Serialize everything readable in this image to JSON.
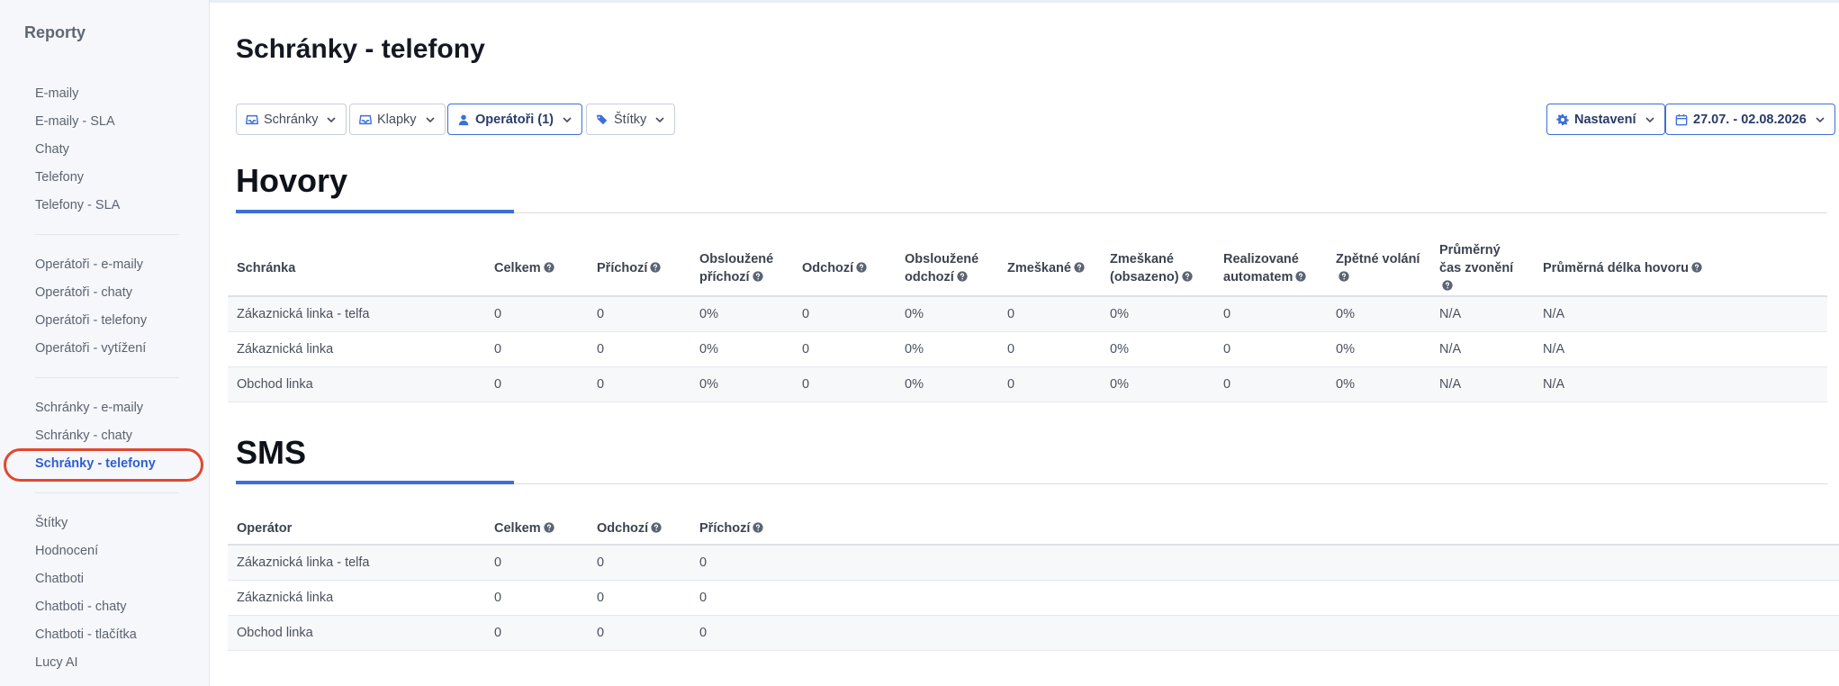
{
  "sidebar": {
    "title": "Reporty",
    "groups": [
      [
        "E-maily",
        "E-maily - SLA",
        "Chaty",
        "Telefony",
        "Telefony - SLA"
      ],
      [
        "Operátoři - e-maily",
        "Operátoři - chaty",
        "Operátoři - telefony",
        "Operátoři - vytížení"
      ],
      [
        "Schránky - e-maily",
        "Schránky - chaty",
        "Schránky - telefony"
      ],
      [
        "Štítky",
        "Hodnocení",
        "Chatboti",
        "Chatboti - chaty",
        "Chatboti - tlačítka",
        "Lucy AI"
      ]
    ],
    "active": "Schránky - telefony"
  },
  "page": {
    "title": "Schránky - telefony"
  },
  "filters": {
    "mailboxes": "Schránky",
    "extensions": "Klapky",
    "operators": "Operátoři (1)",
    "tags": "Štítky",
    "settings": "Nastavení",
    "date_range": "27.07. - 02.08.2026"
  },
  "icons": {
    "mailboxes": "inbox-icon",
    "extensions": "inbox-icon",
    "operators": "user-icon",
    "tags": "tags-icon",
    "settings": "gear-icon",
    "date_range": "calendar-icon",
    "help": "question-circle-icon",
    "dropdown": "chevron-down-icon"
  },
  "calls": {
    "title": "Hovory",
    "columns": [
      {
        "label": "Schránka",
        "help": false
      },
      {
        "label": "Celkem",
        "help": true
      },
      {
        "label": "Příchozí",
        "help": true
      },
      {
        "label": "Obsloužené příchozí",
        "help": true
      },
      {
        "label": "Odchozí",
        "help": true
      },
      {
        "label": "Obsloužené odchozí",
        "help": true
      },
      {
        "label": "Zmeškané",
        "help": true
      },
      {
        "label": "Zmeškané (obsazeno)",
        "help": true
      },
      {
        "label": "Realizované automatem",
        "help": true
      },
      {
        "label": "Zpětné volání",
        "help": true
      },
      {
        "label": "Průměrný čas zvonění",
        "help": true
      },
      {
        "label": "Průměrná délka hovoru",
        "help": true
      }
    ],
    "rows": [
      [
        "Zákaznická linka - telfa",
        "0",
        "0",
        "0%",
        "0",
        "0%",
        "0",
        "0%",
        "0",
        "0%",
        "N/A",
        "N/A"
      ],
      [
        "Zákaznická linka",
        "0",
        "0",
        "0%",
        "0",
        "0%",
        "0",
        "0%",
        "0",
        "0%",
        "N/A",
        "N/A"
      ],
      [
        "Obchod linka",
        "0",
        "0",
        "0%",
        "0",
        "0%",
        "0",
        "0%",
        "0",
        "0%",
        "N/A",
        "N/A"
      ]
    ]
  },
  "sms": {
    "title": "SMS",
    "columns": [
      {
        "label": "Operátor",
        "help": false
      },
      {
        "label": "Celkem",
        "help": true
      },
      {
        "label": "Odchozí",
        "help": true
      },
      {
        "label": "Příchozí",
        "help": true
      }
    ],
    "rows": [
      [
        "Zákaznická linka - telfa",
        "0",
        "0",
        "0"
      ],
      [
        "Zákaznická linka",
        "0",
        "0",
        "0"
      ],
      [
        "Obchod linka",
        "0",
        "0",
        "0"
      ]
    ]
  },
  "colors": {
    "accent": "#3d6fd6",
    "active_link": "#2d5fd3",
    "highlight_ring": "#e2472f"
  }
}
